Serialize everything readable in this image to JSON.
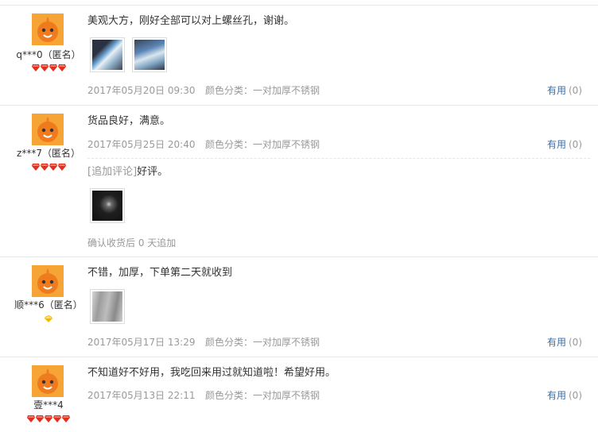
{
  "reviews": [
    {
      "username": "q***0（匿名）",
      "rank": "red-gems-4",
      "text": "美观大方，刚好全部可以对上螺丝孔，谢谢。",
      "photos": [
        "blue-white-panel",
        "blue-white-panel"
      ],
      "date": "2017年05月20日 09:30",
      "sku": "颜色分类：一对加厚不锈钢",
      "useful_label": "有用",
      "useful_count": "(0)"
    },
    {
      "username": "z***7（匿名）",
      "rank": "red-gems-4",
      "text": "货品良好，满意。",
      "date": "2017年05月25日 20:40",
      "sku": "颜色分类：一对加厚不锈钢",
      "useful_label": "有用",
      "useful_count": "(0)",
      "append_tag": "[追加评论]",
      "append_text": "好评。",
      "append_photos": [
        "dark-metal"
      ],
      "append_sub": "确认收货后 0 天追加"
    },
    {
      "username": "顺***6（匿名）",
      "rank": "yellow-diamond-1",
      "text": "不错，加厚，下单第二天就收到",
      "photos": [
        "grey-plate"
      ],
      "date": "2017年05月17日 13:29",
      "sku": "颜色分类：一对加厚不锈钢",
      "useful_label": "有用",
      "useful_count": "(0)"
    },
    {
      "username": "壹***4",
      "rank": "red-gems-5",
      "text": "不知道好不好用，我吃回来用过就知道啦！希望好用。",
      "date": "2017年05月13日 22:11",
      "sku": "颜色分类：一对加厚不锈钢",
      "useful_label": "有用",
      "useful_count": "(0)"
    }
  ],
  "colors": {
    "link": "#3c6ea6",
    "muted": "#999999",
    "gem_red": "#e0301e",
    "gem_yellow": "#f5b800",
    "avatar_orange": "#f08a24"
  }
}
